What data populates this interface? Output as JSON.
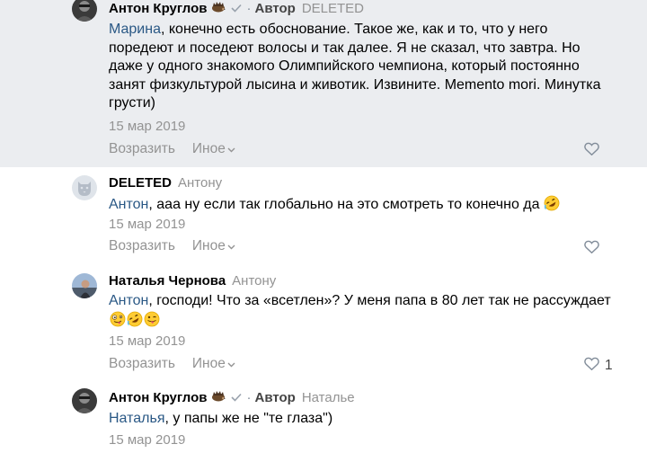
{
  "comments": [
    {
      "author": "Антон Круглов",
      "badge": "Автор",
      "reply_to": "DELETED",
      "mention": "Марина",
      "text": ", конечно есть обоснование. Такое же, как и то, что у него поредеют и поседеют волосы и так далее. Я не сказал, что завтра. Но даже у одного знакомого Олимпийского чемпиона, который постоянно занят физкультурой лысина и животик. Извините. Memento mori. Минутка грусти)",
      "date": "15 мар 2019",
      "reply_label": "Возразить",
      "more_label": "Иное",
      "likes": ""
    },
    {
      "author": "DELETED",
      "reply_to": "Антону",
      "mention": "Антон",
      "text": ", ааа ну если так глобально на это смотреть то конечно да",
      "date": "15 мар 2019",
      "reply_label": "Возразить",
      "more_label": "Иное",
      "likes": ""
    },
    {
      "author": "Наталья Чернова",
      "reply_to": "Антону",
      "mention": "Антон",
      "text": ", господи! Что за «всетлен»? У меня папа в 80 лет так не рассуждает",
      "date": "15 мар 2019",
      "reply_label": "Возразить",
      "more_label": "Иное",
      "likes": "1"
    },
    {
      "author": "Антон Круглов",
      "badge": "Автор",
      "reply_to": "Наталье",
      "mention": "Наталья",
      "text": ", у папы же не \"те глаза\")",
      "date": "15 мар 2019"
    }
  ],
  "separator": "·",
  "icons": {
    "author_emoji": "hedgehog-emoji",
    "verified": "checkmark-icon",
    "like": "heart-icon",
    "more": "chevron-down-icon",
    "rofl": "rofl-emoji",
    "zany": "zany-face-emoji",
    "tongue": "winking-tongue-emoji"
  },
  "colors": {
    "highlight_bg": "#ebedf0",
    "link": "#2a5885",
    "muted": "#939393",
    "text": "#000000"
  }
}
